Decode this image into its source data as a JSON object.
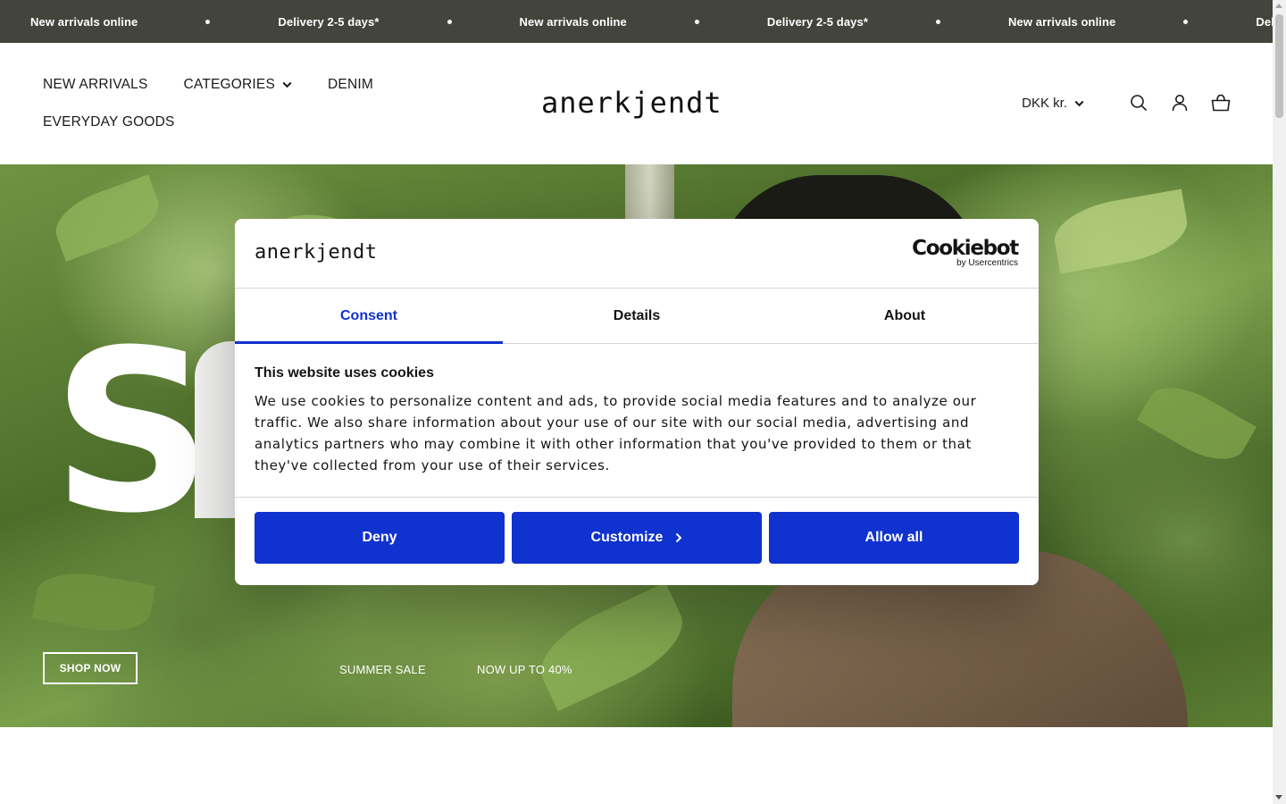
{
  "announcement": {
    "items": [
      "New arrivals online",
      "Delivery 2-5 days*",
      "New arrivals online",
      "Delivery 2-5 days*",
      "New arrivals online",
      "Deliver"
    ]
  },
  "header": {
    "nav": [
      {
        "label": "NEW ARRIVALS"
      },
      {
        "label": "CATEGORIES",
        "icon": "chevron-down-icon"
      },
      {
        "label": "DENIM"
      },
      {
        "label": "EVERYDAY GOODS"
      }
    ],
    "logo": "anerkjendt",
    "currency": "DKK kr.",
    "icons": [
      "search-icon",
      "account-icon",
      "cart-icon"
    ]
  },
  "hero": {
    "headline_fragment": "S",
    "cta": "SHOP NOW",
    "tags": [
      "SUMMER SALE",
      "NOW UP TO 40%"
    ]
  },
  "cookie_dialog": {
    "brand_logo": "anerkjendt",
    "provider": {
      "name": "Cookiebot",
      "byline": "by Usercentrics"
    },
    "tabs": [
      {
        "label": "Consent",
        "active": true
      },
      {
        "label": "Details",
        "active": false
      },
      {
        "label": "About",
        "active": false
      }
    ],
    "title": "This website uses cookies",
    "description": "We use cookies to personalize content and ads, to provide social media features and to analyze our traffic. We also share information about your use of our site with our social media, advertising and analytics partners who may combine it with other information that you've provided to them or that they've collected from your use of their services.",
    "buttons": {
      "deny": "Deny",
      "customize": "Customize",
      "allow_all": "Allow all"
    }
  },
  "colors": {
    "announcement_bg": "#43453c",
    "accent_blue": "#1032cf",
    "text": "#141414"
  }
}
